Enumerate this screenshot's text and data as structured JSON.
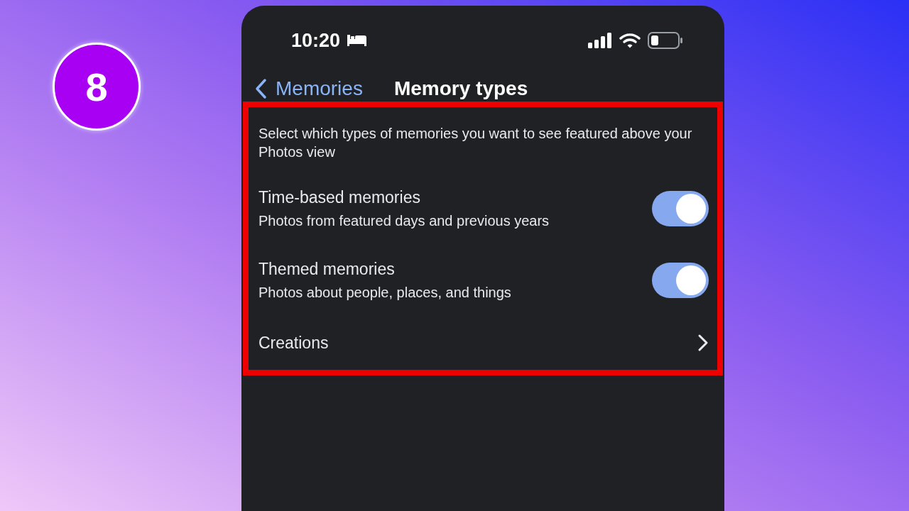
{
  "step_badge": "8",
  "status_bar": {
    "time": "10:20"
  },
  "nav": {
    "back_label": "Memories",
    "title": "Memory types"
  },
  "settings": {
    "description": "Select which types of memories you want to see featured above your Photos view",
    "rows": [
      {
        "kind": "toggle",
        "title": "Time-based memories",
        "subtitle": "Photos from featured days and previous years",
        "on": true
      },
      {
        "kind": "toggle",
        "title": "Themed memories",
        "subtitle": "Photos about people, places, and things",
        "on": true
      },
      {
        "kind": "link",
        "title": "Creations"
      }
    ]
  }
}
